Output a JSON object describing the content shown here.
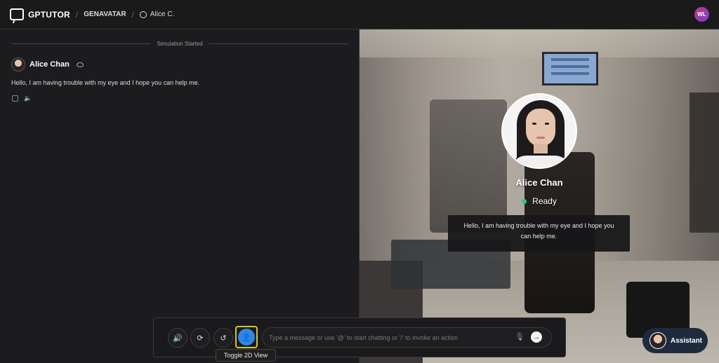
{
  "header": {
    "brand": "GPTUTOR",
    "crumb_1": "GENAVATAR",
    "crumb_2": "Alice C.",
    "user_initials": "WL"
  },
  "chat": {
    "divider_label": "Simulation Started",
    "messages": [
      {
        "sender": "Alice Chan",
        "text": "Hello, I am having trouble with my eye and I hope you can help me."
      }
    ]
  },
  "avatar_view": {
    "name": "Alice Chan",
    "status": "Ready",
    "status_color": "#2ecc71",
    "speech": "Hello, I am having trouble with my eye and I hope you can help me."
  },
  "input": {
    "placeholder": "Type a message or use '@' to start chatting or '/' to invoke an action",
    "value": ""
  },
  "controls": {
    "volume_icon": "speaker-icon",
    "refresh_icon": "refresh-icon",
    "history_icon": "history-icon",
    "toggle_icon": "person-icon",
    "tooltip": "Toggle 2D View",
    "accent": "#2f86e6",
    "highlight": "#d8c426"
  },
  "assistant": {
    "label": "Assistant"
  }
}
